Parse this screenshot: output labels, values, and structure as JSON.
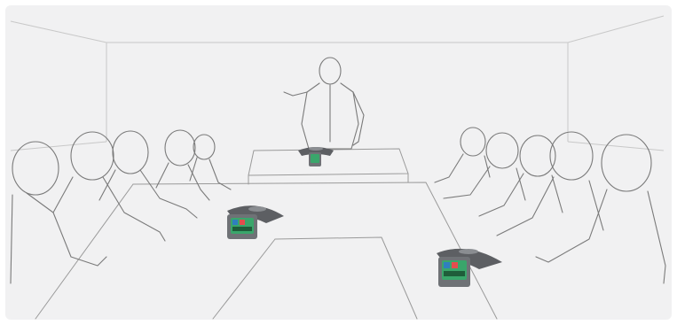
{
  "scene": {
    "kind": "conference-room-illustration",
    "devices": [
      "conference-phone-left",
      "conference-phone-center",
      "conference-phone-right"
    ]
  },
  "colors": {
    "background": "#f1f1f2",
    "line": "#9a9a9a",
    "device_body": "#5d5f63",
    "device_screen": "#3aa66b"
  }
}
